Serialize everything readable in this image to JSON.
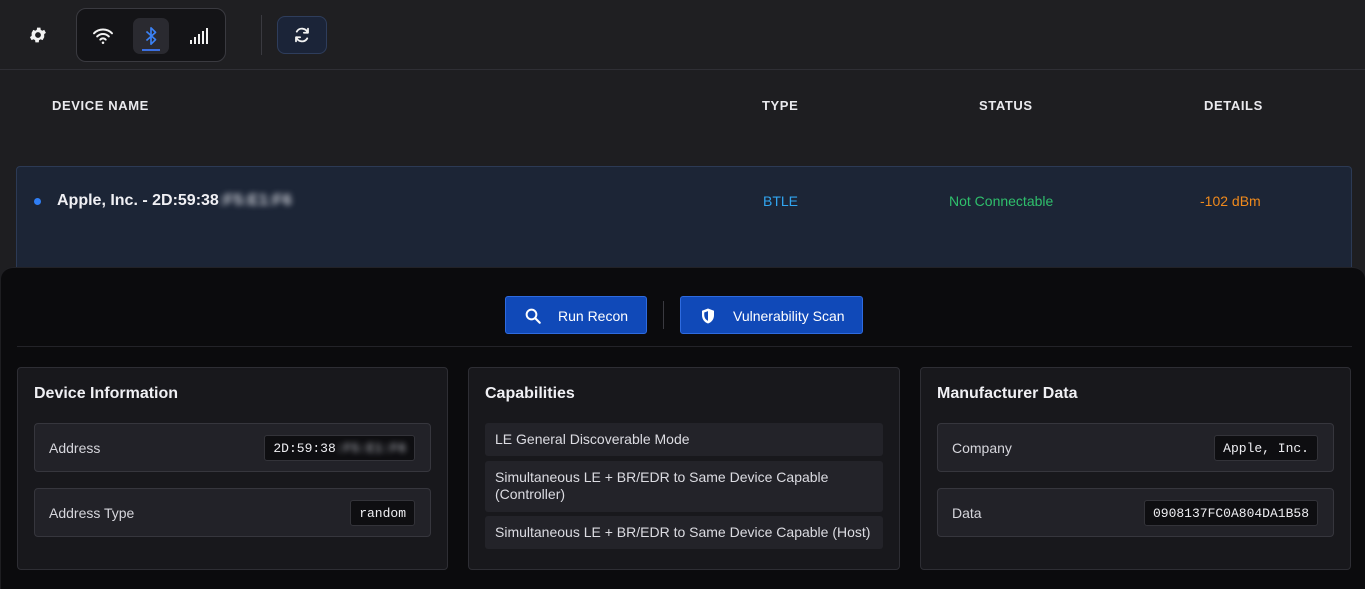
{
  "toolbar": {
    "settings_icon": "gear-icon",
    "modes": [
      {
        "name": "wifi",
        "icon": "wifi-icon",
        "active": false
      },
      {
        "name": "bluetooth",
        "icon": "bluetooth-icon",
        "active": true
      },
      {
        "name": "cellular",
        "icon": "signal-bars-icon",
        "active": false
      }
    ],
    "refresh_icon": "refresh-icon",
    "accent_color": "#3b6fe0"
  },
  "table": {
    "headers": {
      "device_name": "DEVICE NAME",
      "type": "TYPE",
      "status": "STATUS",
      "details": "DETAILS"
    },
    "rows": [
      {
        "name_visible": "Apple, Inc. - 2D:59:38",
        "name_obscured": ":F5:E1:F6",
        "type": "BTLE",
        "status": "Not Connectable",
        "details": "-102 dBm",
        "type_color": "#31a5f0",
        "status_color": "#2fbf6c",
        "details_color": "#f08a1c"
      }
    ]
  },
  "panel": {
    "actions": {
      "run_recon": "Run Recon",
      "vulnerability_scan": "Vulnerability Scan"
    },
    "device_info": {
      "title": "Device Information",
      "address_label": "Address",
      "address_visible": "2D:59:38",
      "address_obscured": ":F5:E1:F6",
      "address_type_label": "Address Type",
      "address_type_value": "random"
    },
    "capabilities": {
      "title": "Capabilities",
      "items": [
        "LE General Discoverable Mode",
        "Simultaneous LE + BR/EDR to Same Device Capable (Controller)",
        "Simultaneous LE + BR/EDR to Same Device Capable (Host)"
      ]
    },
    "manufacturer": {
      "title": "Manufacturer Data",
      "company_label": "Company",
      "company_value": "Apple, Inc.",
      "data_label": "Data",
      "data_value": "0908137FC0A804DA1B58"
    }
  }
}
